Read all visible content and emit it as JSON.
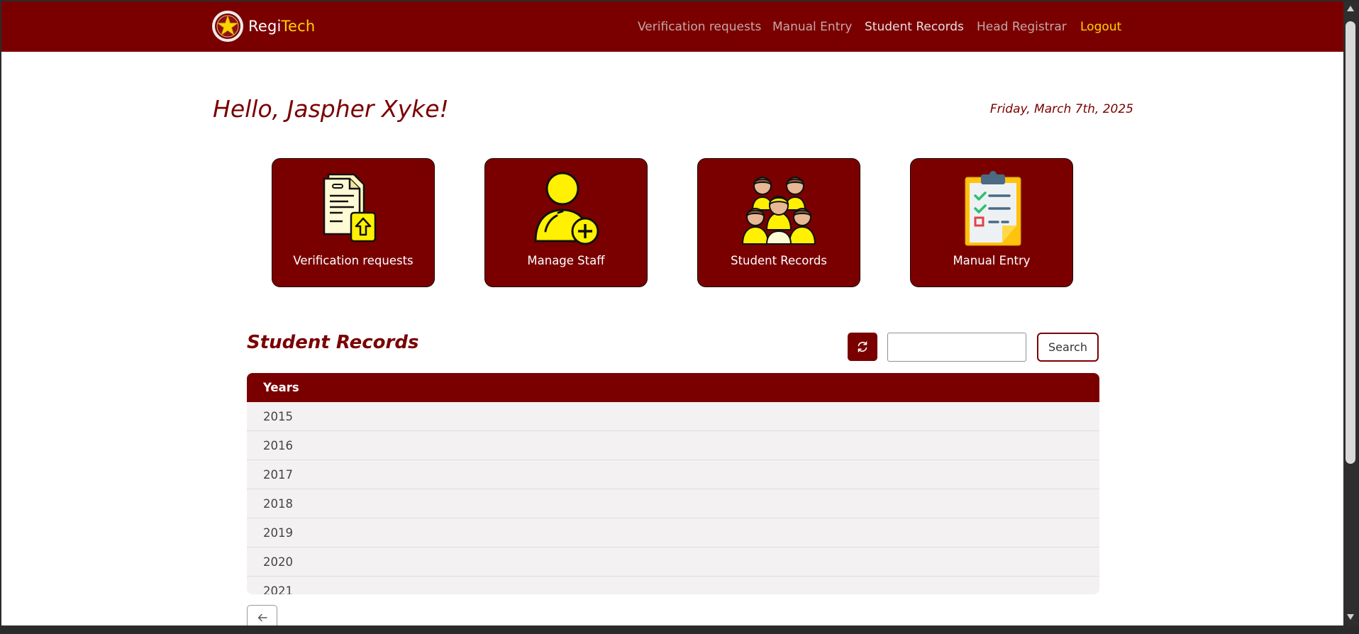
{
  "brand": {
    "name_prefix": "Regi",
    "name_accent": "Tech"
  },
  "nav": {
    "items": [
      {
        "label": "Verification requests"
      },
      {
        "label": "Manual Entry"
      },
      {
        "label": "Student Records"
      },
      {
        "label": "Head Registrar"
      },
      {
        "label": "Logout"
      }
    ]
  },
  "greeting": "Hello, Jaspher Xyke!",
  "date": "Friday, March 7th, 2025",
  "cards": [
    {
      "label": "Verification requests",
      "icon": "document-upload-icon"
    },
    {
      "label": "Manage Staff",
      "icon": "add-user-icon"
    },
    {
      "label": "Student Records",
      "icon": "students-group-icon"
    },
    {
      "label": "Manual Entry",
      "icon": "clipboard-checklist-icon"
    }
  ],
  "records": {
    "title": "Student Records",
    "search_value": "",
    "search_label": "Search",
    "column_header": "Years",
    "rows": [
      "2015",
      "2016",
      "2017",
      "2018",
      "2019",
      "2020",
      "2021"
    ]
  },
  "colors": {
    "primary": "#7a0000",
    "accent": "#ffd400",
    "row_bg": "#f3f1f1"
  }
}
